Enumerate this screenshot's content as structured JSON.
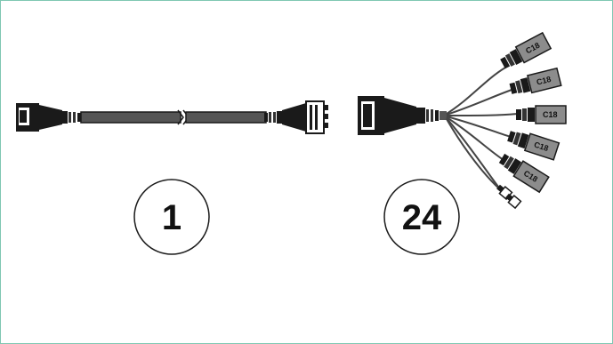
{
  "items": [
    {
      "number": "1",
      "name": "extension cable"
    },
    {
      "number": "24",
      "name": "splitter cable"
    }
  ],
  "connector_label": "C18",
  "colors": {
    "frame_border": "#7fc7b2",
    "cable_dark": "#1a1a1a",
    "cable_mid": "#555555",
    "connector_grey": "#8c8c8c"
  }
}
